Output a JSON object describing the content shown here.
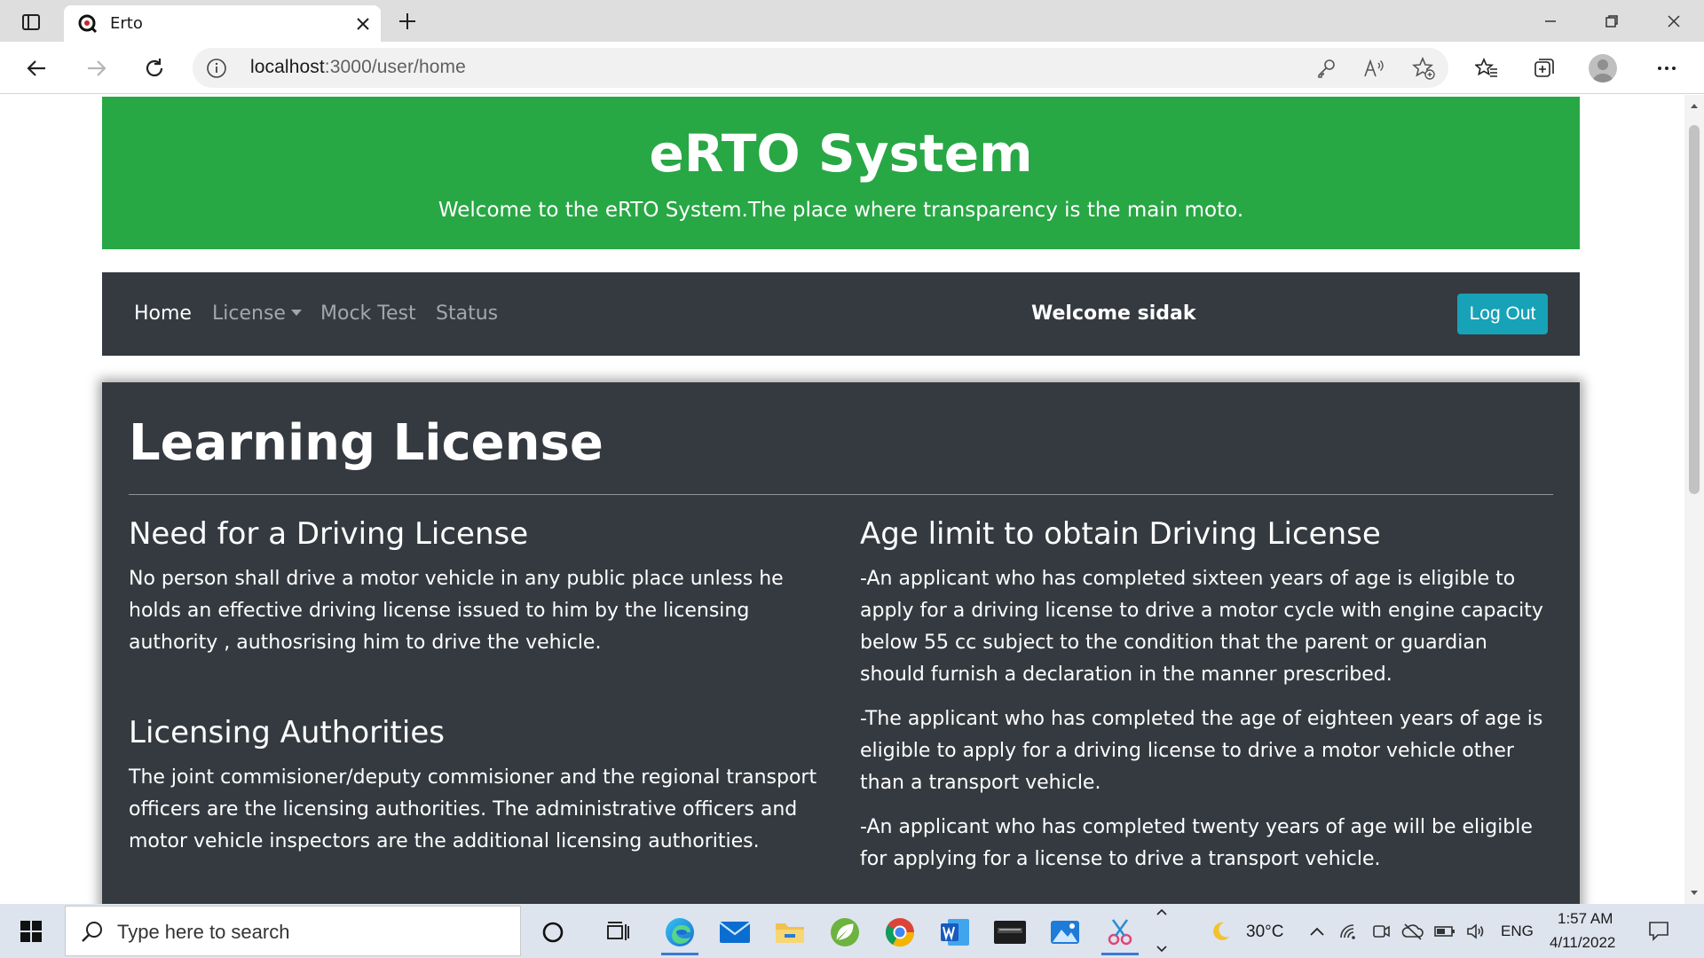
{
  "browser": {
    "tab_title": "Erto",
    "url_host": "localhost",
    "url_path": ":3000/user/home",
    "icons": [
      "tab-actions-icon",
      "close-icon",
      "plus-icon",
      "minimize-icon",
      "restore-icon",
      "close-window-icon",
      "back-icon",
      "forward-icon",
      "refresh-icon",
      "info-icon",
      "key-icon",
      "read-aloud-icon",
      "add-favorite-icon",
      "favorites-icon",
      "collections-icon",
      "profile-icon",
      "more-icon"
    ]
  },
  "header": {
    "title": "eRTO System",
    "subtitle": "Welcome to the eRTO System.The place where transparency is the main moto.",
    "color": "#28a745"
  },
  "navbar": {
    "items": [
      "Home",
      "License",
      "Mock Test",
      "Status"
    ],
    "welcome": "Welcome sidak",
    "logout": "Log Out",
    "color": "#343a40",
    "logout_color": "#17a2b8"
  },
  "card": {
    "title": "Learning License",
    "left": [
      {
        "heading": "Need for a Driving License",
        "paragraphs": [
          "No person shall drive a motor vehicle in any public place unless he holds an effective driving license issued to him by the licensing authority , authosrising him to drive the vehicle."
        ]
      },
      {
        "heading": "Licensing Authorities",
        "paragraphs": [
          "The joint commisioner/deputy commisioner and the regional transport officers are the licensing authorities. The administrative officers and motor vehicle inspectors are the additional licensing authorities."
        ]
      }
    ],
    "right": [
      {
        "heading": "Age limit to obtain Driving License",
        "paragraphs": [
          "-An applicant who has completed sixteen years of age is eligible to apply for a driving license to drive a motor cycle with engine capacity below 55 cc subject to the condition that the parent or guardian should furnish a declaration in the manner prescribed.",
          "-The applicant who has completed the age of eighteen years of age is eligible to apply for a driving license to drive a motor vehicle other than a transport vehicle.",
          "-An applicant who has completed twenty years of age will be eligible for applying for a license to drive a transport vehicle."
        ]
      }
    ]
  },
  "taskbar": {
    "search_placeholder": "Type here to search",
    "weather": "30°C",
    "language": "ENG",
    "time": "1:57 AM",
    "date": "4/11/2022",
    "apps": [
      "cortana-icon",
      "task-view-icon",
      "edge-icon",
      "mail-icon",
      "file-explorer-icon",
      "spring-icon",
      "chrome-icon",
      "word-icon",
      "mysql-icon",
      "photos-icon",
      "snipping-icon"
    ]
  }
}
